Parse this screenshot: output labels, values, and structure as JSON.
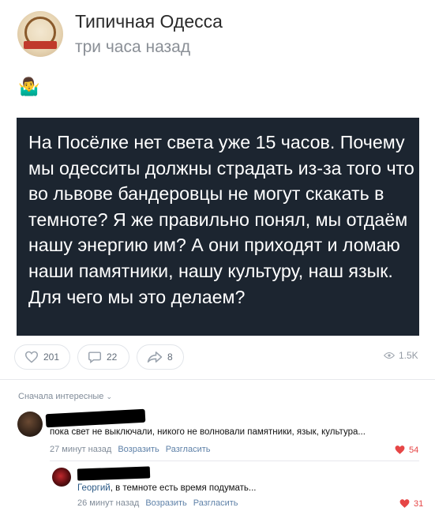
{
  "header": {
    "group_name": "Типичная Одесса",
    "post_time": "три часа назад",
    "avatar_icon": "ship-wheel-logo-icon"
  },
  "post": {
    "emoji": "🤷‍♂️",
    "text": "На Посёлке нет света уже 15 часов. Почему мы одесситы должны страдать из-за того что во львове бандеровцы не могут скакать в темноте? Я же правильно понял, мы отдаём нашу энергию им? А они приходят и ломаю наши памятники, нашу культуру, наш язык. Для чего мы это делаем?",
    "background_color": "#1c2530"
  },
  "actions": {
    "likes": "201",
    "comments": "22",
    "shares": "8",
    "views": "1.5K"
  },
  "comments": {
    "sort_label": "Сначала интересные",
    "items": [
      {
        "text": "пока свет не выключали, никого не волновали памятники, язык, культура...",
        "time": "27 минут назад",
        "reply_label": "Возразить",
        "share_label": "Разгласить",
        "likes": "54"
      },
      {
        "mention": "Георгий",
        "text": ", в темноте есть время подумать...",
        "time": "26 минут назад",
        "reply_label": "Возразить",
        "share_label": "Разгласить",
        "likes": "31"
      }
    ]
  },
  "colors": {
    "accent_link": "#5e81a8",
    "like_red": "#e64646",
    "meta_gray": "#818c99"
  }
}
